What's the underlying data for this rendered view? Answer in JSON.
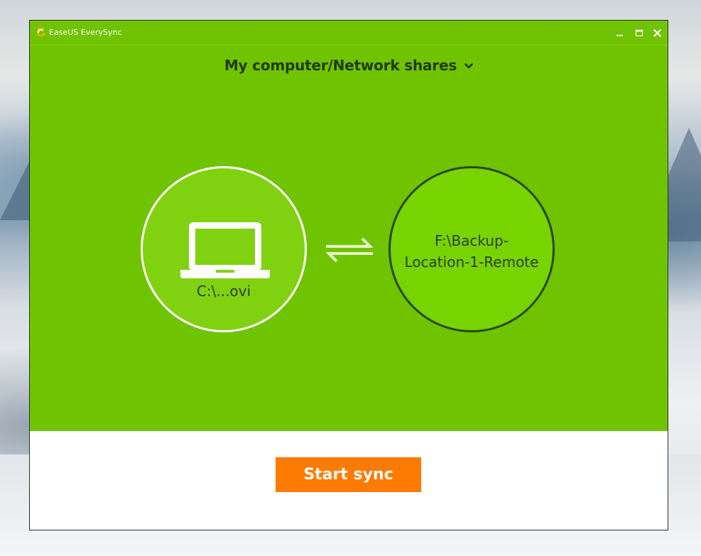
{
  "window": {
    "title": "EaseUS EverySync",
    "controls": {
      "minimize_icon": "minimize-icon",
      "maximize_icon": "maximize-icon",
      "close_icon": "close-icon"
    }
  },
  "header": {
    "location_selector": "My computer/Network shares",
    "dropdown_icon": "chevron-down-icon"
  },
  "source": {
    "icon": "laptop-icon",
    "path": "C:\\...ovi"
  },
  "sync": {
    "icon": "sync-arrows-icon"
  },
  "destination": {
    "path_line1": "F:\\Backup-",
    "path_line2": "Location-1-Remote"
  },
  "footer": {
    "start_button": "Start sync"
  },
  "colors": {
    "brand_green": "#70c300",
    "source_circle_fill": "#80d211",
    "destination_circle_fill": "#78d400",
    "destination_circle_border": "#2a4712",
    "accent_orange": "#ff7a00",
    "text_dark": "#1f3a05"
  }
}
